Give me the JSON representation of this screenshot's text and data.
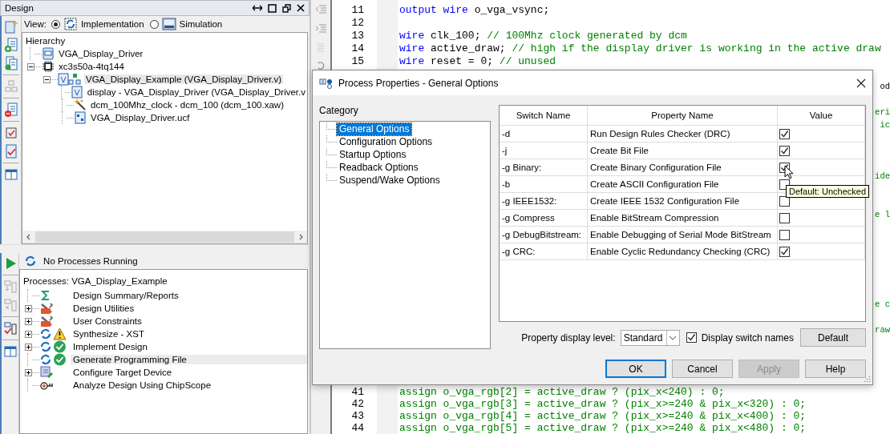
{
  "design": {
    "title": "Design",
    "view_label": "View:",
    "views": [
      {
        "label": "Implementation",
        "kind": "implementation",
        "selected": true
      },
      {
        "label": "Simulation",
        "kind": "simulation",
        "selected": false
      }
    ],
    "hierarchy": {
      "title": "Hierarchy",
      "items": [
        {
          "label": "VGA_Display_Driver",
          "kind": "project",
          "selected": false
        },
        {
          "label": "xc3s50a-4tq144",
          "kind": "chip",
          "expanded": true,
          "selected": false,
          "children": [
            {
              "label": "VGA_Display_Example (VGA_Display_Driver.v)",
              "kind": "top",
              "expanded": true,
              "selected": true,
              "children": [
                {
                  "label": "display - VGA_Display_Driver (VGA_Display_Driver.v",
                  "kind": "verilog",
                  "selected": false
                },
                {
                  "label": "dcm_100Mhz_clock - dcm_100 (dcm_100.xaw)",
                  "kind": "wizard",
                  "selected": false
                },
                {
                  "label": "VGA_Display_Driver.ucf",
                  "kind": "constraints",
                  "selected": false
                }
              ]
            }
          ]
        }
      ]
    }
  },
  "processes": {
    "status": "No Processes Running",
    "title": "Processes: VGA_Display_Example",
    "items": [
      {
        "label": "Design Summary/Reports",
        "kind": "summary",
        "selected": false
      },
      {
        "label": "Design Utilities",
        "kind": "tools",
        "expanded": false,
        "selected": false
      },
      {
        "label": "User Constraints",
        "kind": "tools",
        "expanded": false,
        "selected": false
      },
      {
        "label": "Synthesize - XST",
        "kind": "warning",
        "expanded": false,
        "selected": false
      },
      {
        "label": "Implement Design",
        "kind": "done",
        "expanded": false,
        "selected": false
      },
      {
        "label": "Generate Programming File",
        "kind": "done",
        "selected": true
      },
      {
        "label": "Configure Target Device",
        "kind": "device",
        "expanded": false,
        "selected": false
      },
      {
        "label": "Analyze Design Using ChipScope",
        "kind": "probe",
        "selected": false
      }
    ]
  },
  "editor": {
    "lines": [
      {
        "number": "11",
        "tokens": [
          {
            "text": "output wire",
            "kind": "keyword"
          },
          {
            "text": " o_vga_vsync;",
            "kind": "plain"
          }
        ]
      },
      {
        "number": "12"
      },
      {
        "number": "13",
        "tokens": [
          {
            "text": "wire",
            "kind": "keyword"
          },
          {
            "text": " clk_100; ",
            "kind": "plain"
          },
          {
            "text": "// 100Mhz clock generated by dcm",
            "kind": "comment"
          }
        ]
      },
      {
        "number": "14",
        "tokens": [
          {
            "text": "wire",
            "kind": "keyword"
          },
          {
            "text": " active_draw; ",
            "kind": "plain"
          },
          {
            "text": "// high if the display driver is working in the active draw",
            "kind": "comment"
          }
        ]
      },
      {
        "number": "15",
        "tokens": [
          {
            "text": "wire",
            "kind": "keyword"
          },
          {
            "text": " reset = 0; ",
            "kind": "plain"
          },
          {
            "text": "// unused",
            "kind": "comment"
          }
        ]
      }
    ],
    "covered_tails": [
      {
        "text": "od",
        "kind": "plain"
      },
      {
        "text": "eri",
        "kind": "comment"
      },
      {
        "text": "ic",
        "kind": "comment"
      },
      {
        "text": "ide",
        "kind": "comment"
      },
      {
        "text": "e l",
        "kind": "comment"
      },
      {
        "text": "e c",
        "kind": "comment"
      },
      {
        "text": "raw",
        "kind": "comment"
      }
    ],
    "lines_below": [
      {
        "number": "41",
        "tokens": [
          {
            "text": "assign o_vga_rgb[2] = active_draw ? (pix_x<240) : 0;",
            "kind": "comment"
          }
        ]
      },
      {
        "number": "42",
        "tokens": [
          {
            "text": "assign o_vga_rgb[3] = active_draw ? (pix_x>=240 & pix_x<320) : 0;",
            "kind": "comment"
          }
        ]
      },
      {
        "number": "43",
        "tokens": [
          {
            "text": "assign o_vga_rgb[4] = active_draw ? (pix_x>=240 & pix_x<400) : 0;",
            "kind": "comment"
          }
        ]
      },
      {
        "number": "44",
        "tokens": [
          {
            "text": "assign o_vga_rgb[5] = active_draw ? (pix_x>=240 & pix_x<480) : 0;",
            "kind": "comment"
          }
        ]
      }
    ]
  },
  "dialog": {
    "title": "Process Properties - General Options",
    "category_label": "Category",
    "categories": [
      {
        "label": "General Options",
        "selected": true
      },
      {
        "label": "Configuration Options",
        "selected": false
      },
      {
        "label": "Startup Options",
        "selected": false
      },
      {
        "label": "Readback Options",
        "selected": false
      },
      {
        "label": "Suspend/Wake Options",
        "selected": false
      }
    ],
    "columns": [
      "Switch Name",
      "Property Name",
      "Value"
    ],
    "rows": [
      {
        "switch": "-d",
        "property": "Run Design Rules Checker (DRC)",
        "checked": true
      },
      {
        "switch": "-j",
        "property": "Create Bit File",
        "checked": true
      },
      {
        "switch": "-g Binary:",
        "property": "Create Binary Configuration File",
        "checked": true
      },
      {
        "switch": "-b",
        "property": "Create ASCII Configuration File",
        "checked": false
      },
      {
        "switch": "-g IEEE1532:",
        "property": "Create IEEE 1532 Configuration File",
        "checked": false
      },
      {
        "switch": "-g Compress",
        "property": "Enable BitStream Compression",
        "checked": false
      },
      {
        "switch": "-g DebugBitstream:",
        "property": "Enable Debugging of Serial Mode BitStream",
        "checked": false
      },
      {
        "switch": "-g CRC:",
        "property": "Enable Cyclic Redundancy Checking (CRC)",
        "checked": true
      }
    ],
    "tooltip": "Default: Unchecked",
    "display_level": {
      "label": "Property display level:",
      "value": "Standard"
    },
    "switch_names": {
      "label": "Display switch names",
      "checked": true
    },
    "default_button": "Default",
    "buttons": [
      {
        "label": "OK",
        "default": true,
        "disabled": false
      },
      {
        "label": "Cancel",
        "default": false,
        "disabled": false
      },
      {
        "label": "Apply",
        "default": false,
        "disabled": true
      },
      {
        "label": "Help",
        "default": false,
        "disabled": false
      }
    ]
  }
}
